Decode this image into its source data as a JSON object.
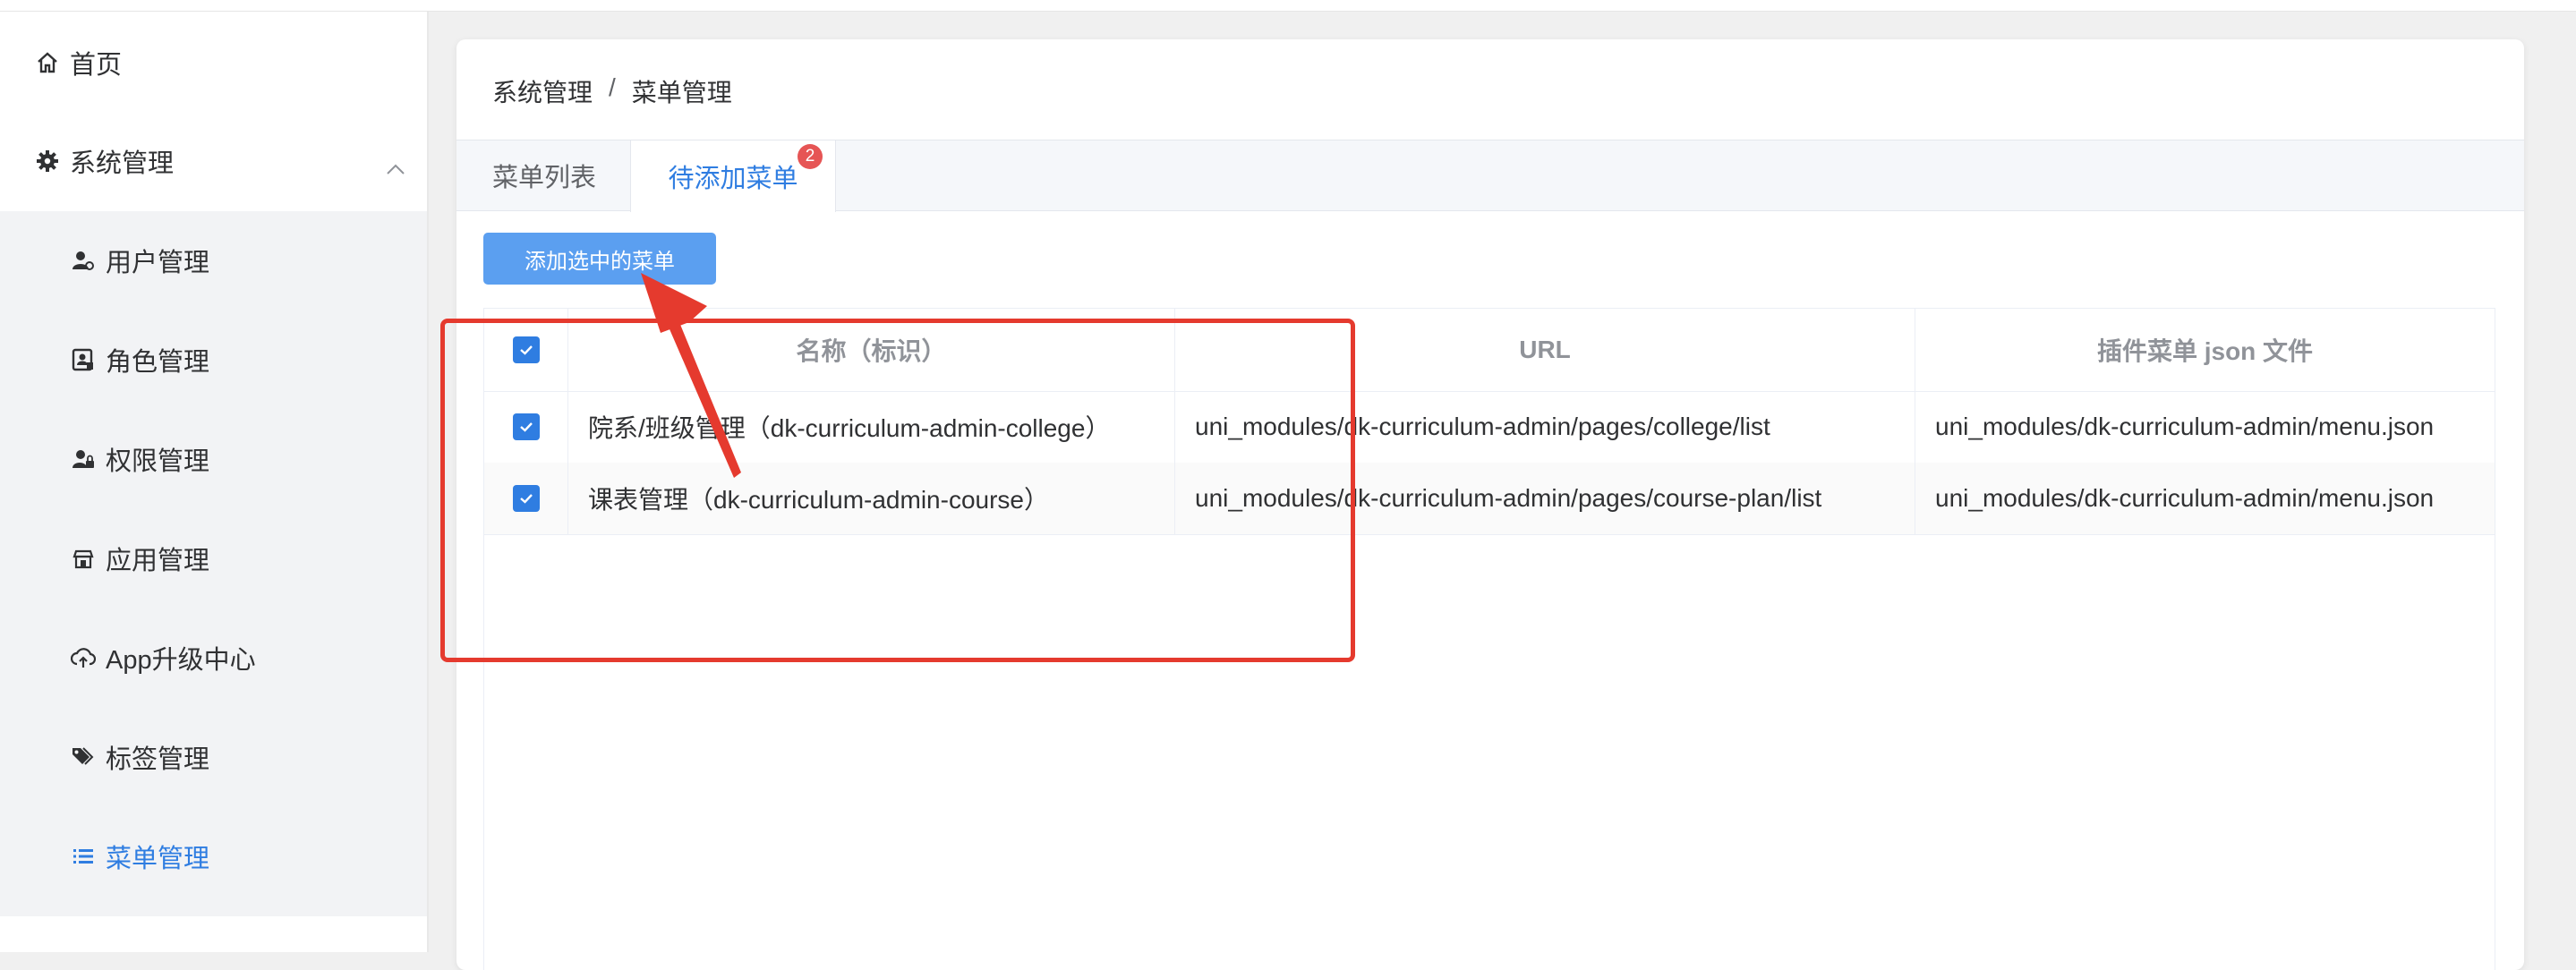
{
  "sidebar": {
    "home": "首页",
    "system": "系统管理",
    "items": [
      {
        "label": "用户管理",
        "icon": "user-gear-icon"
      },
      {
        "label": "角色管理",
        "icon": "role-icon"
      },
      {
        "label": "权限管理",
        "icon": "permission-icon"
      },
      {
        "label": "应用管理",
        "icon": "app-icon"
      },
      {
        "label": "App升级中心",
        "icon": "cloud-upload-icon"
      },
      {
        "label": "标签管理",
        "icon": "tag-icon"
      },
      {
        "label": "菜单管理",
        "icon": "list-icon"
      }
    ],
    "active_color": "#2f7de1"
  },
  "breadcrumb": {
    "root": "系统管理",
    "sep": "/",
    "current": "菜单管理"
  },
  "tabs": [
    {
      "label": "菜单列表"
    },
    {
      "label": "待添加菜单",
      "badge": "2"
    }
  ],
  "toolbar": {
    "add_label": "添加选中的菜单"
  },
  "table": {
    "columns": [
      "名称（标识）",
      "URL",
      "插件菜单 json 文件"
    ],
    "rows": [
      {
        "name": "院系/班级管理（dk-curriculum-admin-college）",
        "url": "uni_modules/dk-curriculum-admin/pages/college/list",
        "file": "uni_modules/dk-curriculum-admin/menu.json",
        "checked": true
      },
      {
        "name": "课表管理（dk-curriculum-admin-course）",
        "url": "uni_modules/dk-curriculum-admin/pages/course-plan/list",
        "file": "uni_modules/dk-curriculum-admin/menu.json",
        "checked": true
      }
    ]
  },
  "annotation_color": "#e53a2e"
}
